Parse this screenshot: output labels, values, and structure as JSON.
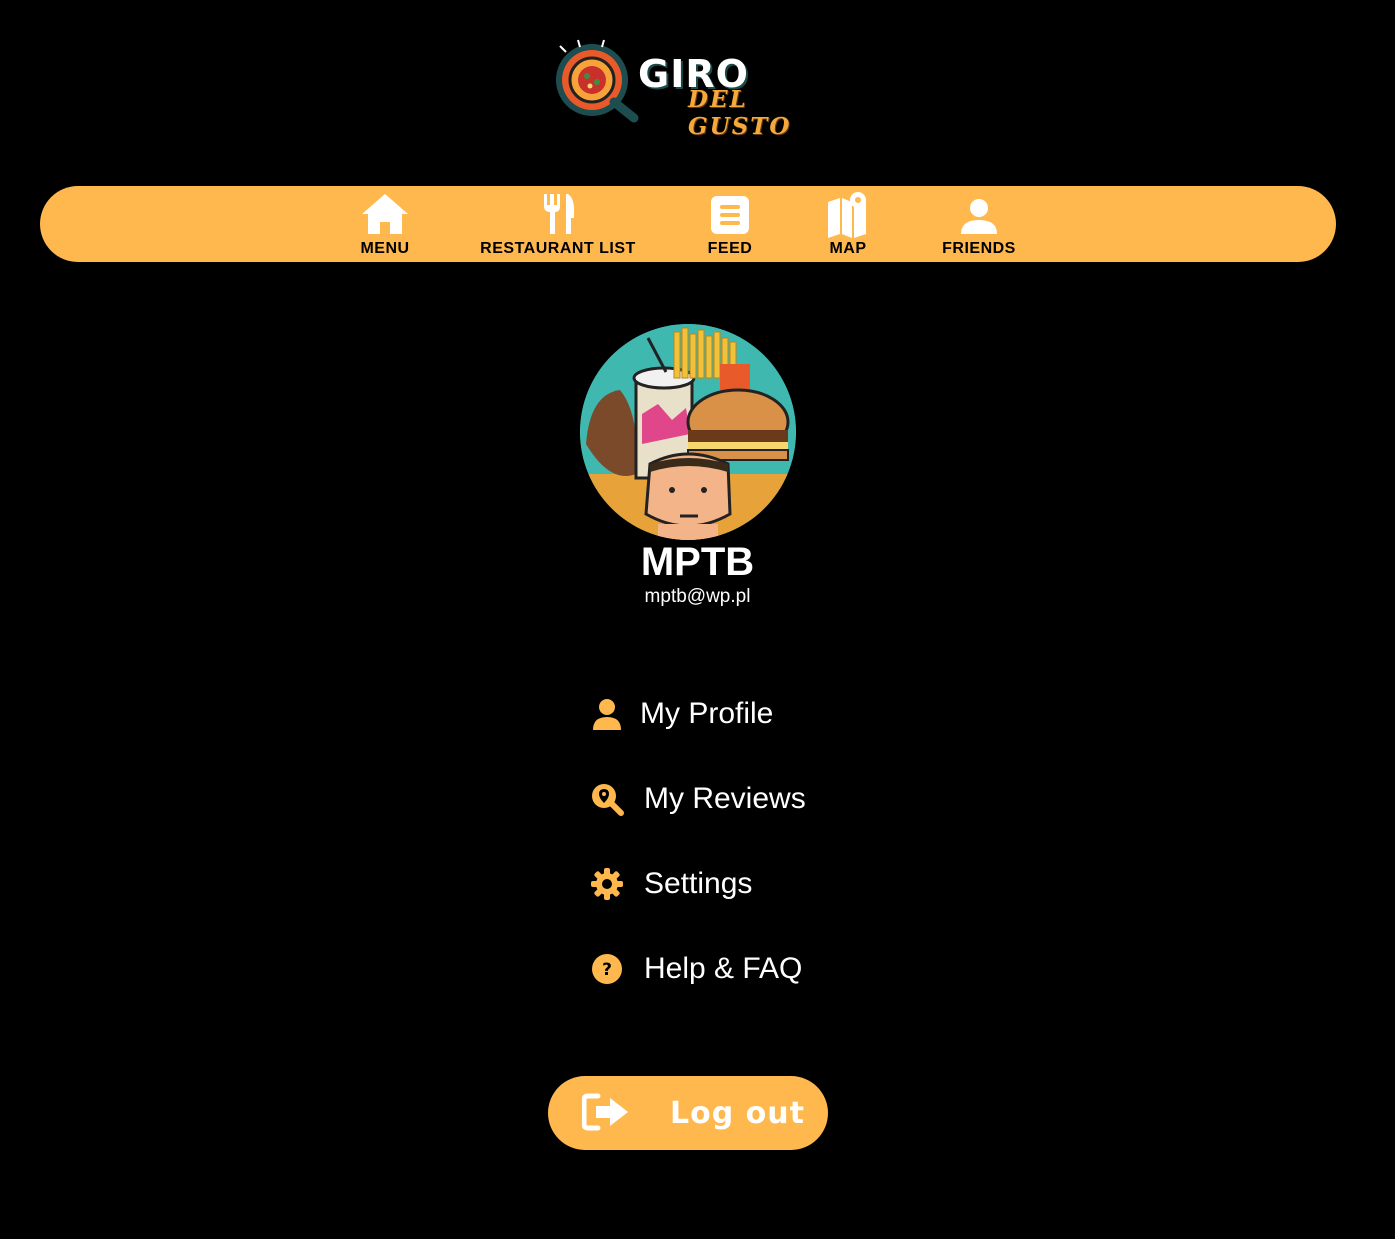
{
  "logo": {
    "line1": "GIRO",
    "line2": "DEL GUSTO"
  },
  "nav": {
    "items": [
      {
        "label": "MENU",
        "icon": "home-icon"
      },
      {
        "label": "RESTAURANT LIST",
        "icon": "fork-knife-icon"
      },
      {
        "label": "FEED",
        "icon": "feed-icon"
      },
      {
        "label": "MAP",
        "icon": "map-icon"
      },
      {
        "label": "FRIENDS",
        "icon": "user-icon"
      }
    ]
  },
  "profile": {
    "username": "MPTB",
    "email": "mptb@wp.pl"
  },
  "menu": {
    "items": [
      {
        "label": "My Profile",
        "icon": "user-icon"
      },
      {
        "label": "My Reviews",
        "icon": "search-location-icon"
      },
      {
        "label": "Settings",
        "icon": "gear-icon"
      },
      {
        "label": "Help & FAQ",
        "icon": "question-icon"
      }
    ]
  },
  "logout": {
    "label": "Log out",
    "icon": "logout-icon"
  },
  "colors": {
    "background": "#000000",
    "accent": "#ffb84d",
    "text": "#ffffff"
  }
}
